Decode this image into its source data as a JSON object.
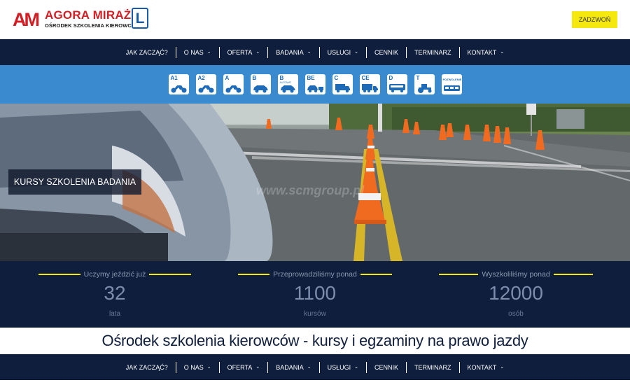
{
  "header": {
    "logo_mark": "AM",
    "logo_name": "AGORA MIRAŻ",
    "logo_sub": "OŚRODEK SZKOLENIA KIEROWCÓW",
    "logo_plate": "L",
    "call_button": "ZADZWOŃ"
  },
  "nav": {
    "items": [
      {
        "label": "JAK ZACZĄĆ?",
        "has_dropdown": false
      },
      {
        "label": "O NAS",
        "has_dropdown": true
      },
      {
        "label": "OFERTA",
        "has_dropdown": true
      },
      {
        "label": "BADANIA",
        "has_dropdown": true
      },
      {
        "label": "USŁUGI",
        "has_dropdown": true
      },
      {
        "label": "CENNIK",
        "has_dropdown": false
      },
      {
        "label": "TERMINARZ",
        "has_dropdown": false
      },
      {
        "label": "KONTAKT",
        "has_dropdown": true
      }
    ],
    "dropdown_icon": "chevron-down-icon"
  },
  "categories": [
    {
      "label": "A1",
      "icon": "motorcycle-icon"
    },
    {
      "label": "A2",
      "icon": "motorcycle-icon"
    },
    {
      "label": "A",
      "icon": "motorcycle-icon"
    },
    {
      "label": "B",
      "icon": "car-icon"
    },
    {
      "label": "B",
      "sublabel": "AUTOMAT",
      "icon": "car-icon"
    },
    {
      "label": "BE",
      "icon": "car-trailer-icon"
    },
    {
      "label": "C",
      "icon": "truck-icon"
    },
    {
      "label": "CE",
      "icon": "truck-trailer-icon"
    },
    {
      "label": "D",
      "icon": "bus-icon"
    },
    {
      "label": "T",
      "icon": "tractor-icon"
    },
    {
      "label": "POZWOLENIE",
      "icon": "tram-icon"
    }
  ],
  "hero": {
    "label": "KURSY SZKOLENIA BADANIA",
    "watermark": "www.scmgroup.pl"
  },
  "stats": [
    {
      "caption": "Uczymy jeździć już",
      "value": "32",
      "unit": "lata"
    },
    {
      "caption": "Przeprowadziliśmy ponad",
      "value": "1100",
      "unit": "kursów"
    },
    {
      "caption": "Wyszkoliliśmy ponad",
      "value": "12000",
      "unit": "osób"
    }
  ],
  "page_heading": "Ośrodek szkolenia kierowców - kursy i egzaminy na prawo jazdy",
  "colors": {
    "brand_red": "#d21f26",
    "navy": "#0f1e3c",
    "category_blue": "#3a8ad0",
    "accent_yellow": "#f5e80f"
  }
}
